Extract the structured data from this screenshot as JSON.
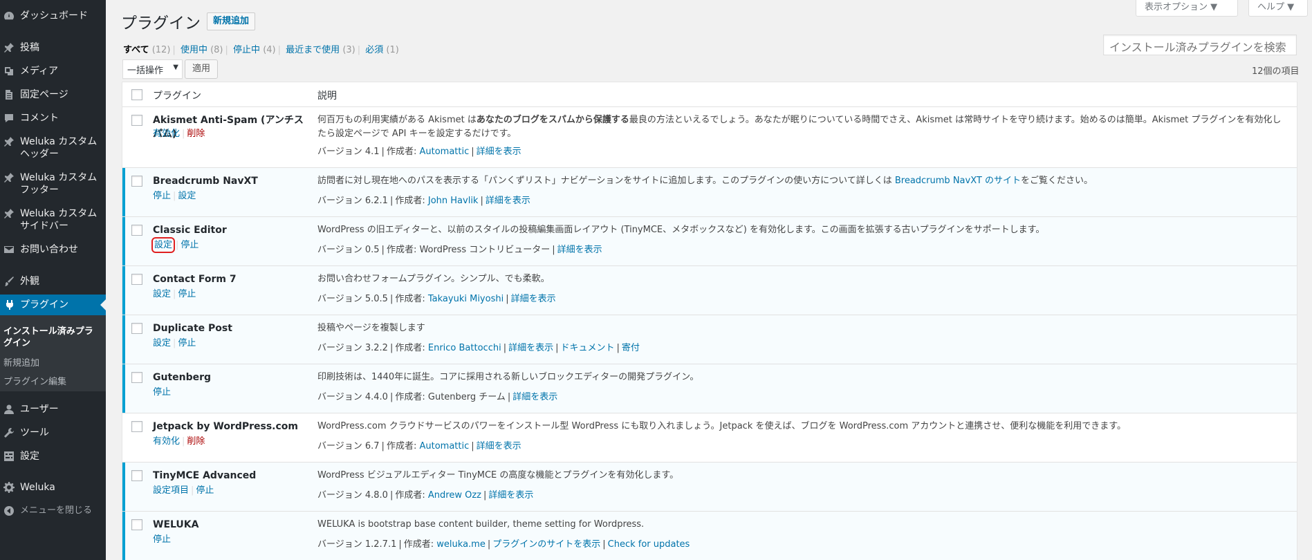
{
  "sidebar": {
    "items": [
      {
        "label": "ダッシュボード",
        "icon": "dashboard-icon"
      },
      {
        "label": "投稿",
        "icon": "pin-icon"
      },
      {
        "label": "メディア",
        "icon": "media-icon"
      },
      {
        "label": "固定ページ",
        "icon": "page-icon"
      },
      {
        "label": "コメント",
        "icon": "comment-icon"
      },
      {
        "label": "Weluka カスタムヘッダー",
        "icon": "pin-icon"
      },
      {
        "label": "Weluka カスタムフッター",
        "icon": "pin-icon"
      },
      {
        "label": "Weluka カスタムサイドバー",
        "icon": "pin-icon"
      },
      {
        "label": "お問い合わせ",
        "icon": "mail-icon"
      },
      {
        "label": "外観",
        "icon": "brush-icon"
      },
      {
        "label": "プラグイン",
        "icon": "plugin-icon"
      },
      {
        "label": "ユーザー",
        "icon": "user-icon"
      },
      {
        "label": "ツール",
        "icon": "wrench-icon"
      },
      {
        "label": "設定",
        "icon": "settings-icon"
      },
      {
        "label": "Weluka",
        "icon": "gear-icon"
      },
      {
        "label": "メニューを閉じる",
        "icon": "collapse-icon"
      }
    ],
    "submenu": [
      "インストール済みプラグイン",
      "新規追加",
      "プラグイン編集"
    ]
  },
  "header": {
    "title": "プラグイン",
    "add_new": "新規追加",
    "screen_options": "表示オプション ▼",
    "help": "ヘルプ ▼"
  },
  "filters": [
    {
      "label": "すべて",
      "count": "(12)"
    },
    {
      "label": "使用中",
      "count": "(8)"
    },
    {
      "label": "停止中",
      "count": "(4)"
    },
    {
      "label": "最近まで使用",
      "count": "(3)"
    },
    {
      "label": "必須",
      "count": "(1)"
    }
  ],
  "search": {
    "placeholder": "インストール済みプラグインを検索"
  },
  "bulk": {
    "select": "一括操作",
    "apply": "適用",
    "count": "12個の項目"
  },
  "table": {
    "col_plugin": "プラグイン",
    "col_desc": "説明",
    "rows": [
      {
        "name": "Akismet Anti-Spam (アンチスパム)",
        "actions": [
          "有効化",
          "削除"
        ],
        "desc_parts": [
          "何百万もの利用実績がある Akismet は",
          "あなたのブログをスパムから保護する",
          "最良の方法といえるでしょう。あなたが眠りについている時間でさえ、Akismet は常時サイトを守り続けます。始めるのは簡単。Akismet プラグインを有効化したら設定ページで API キーを設定するだけです。"
        ],
        "version": "バージョン 4.1",
        "author_label": "作成者:",
        "author": "Automattic",
        "links": [
          "詳細を表示"
        ]
      },
      {
        "name": "Breadcrumb NavXT",
        "actions": [
          "停止",
          "設定"
        ],
        "desc_parts": [
          "訪問者に対し現在地へのパスを表示する「パンくずリスト」ナビゲーションをサイトに追加します。このプラグインの使い方について詳しくは ",
          "Breadcrumb NavXT のサイト",
          "をご覧ください。"
        ],
        "version": "バージョン 6.2.1",
        "author_label": "作成者:",
        "author": "John Havlik",
        "links": [
          "詳細を表示"
        ]
      },
      {
        "name": "Classic Editor",
        "actions": [
          "設定",
          "停止"
        ],
        "desc": "WordPress の旧エディターと、以前のスタイルの投稿編集画面レイアウト (TinyMCE、メタボックスなど) を有効化します。この画面を拡張する古いプラグインをサポートします。",
        "version": "バージョン 0.5",
        "author_label": "作成者:",
        "author": "WordPress コントリビューター",
        "links": [
          "詳細を表示"
        ]
      },
      {
        "name": "Contact Form 7",
        "actions": [
          "設定",
          "停止"
        ],
        "desc": "お問い合わせフォームプラグイン。シンプル、でも柔軟。",
        "version": "バージョン 5.0.5",
        "author_label": "作成者:",
        "author": "Takayuki Miyoshi",
        "links": [
          "詳細を表示"
        ]
      },
      {
        "name": "Duplicate Post",
        "actions": [
          "設定",
          "停止"
        ],
        "desc": "投稿やページを複製します",
        "version": "バージョン 3.2.2",
        "author_label": "作成者:",
        "author": "Enrico Battocchi",
        "links": [
          "詳細を表示",
          "ドキュメント",
          "寄付"
        ]
      },
      {
        "name": "Gutenberg",
        "actions": [
          "停止"
        ],
        "desc": "印刷技術は、1440年に誕生。コアに採用される新しいブロックエディターの開発プラグイン。",
        "version": "バージョン 4.4.0",
        "author_label": "作成者:",
        "author": "Gutenberg チーム",
        "links": [
          "詳細を表示"
        ]
      },
      {
        "name": "Jetpack by WordPress.com",
        "actions": [
          "有効化",
          "削除"
        ],
        "desc": "WordPress.com クラウドサービスのパワーをインストール型 WordPress にも取り入れましょう。Jetpack を使えば、ブログを WordPress.com アカウントと連携させ、便利な機能を利用できます。",
        "version": "バージョン 6.7",
        "author_label": "作成者:",
        "author": "Automattic",
        "links": [
          "詳細を表示"
        ]
      },
      {
        "name": "TinyMCE Advanced",
        "actions": [
          "設定項目",
          "停止"
        ],
        "desc": "WordPress ビジュアルエディター TinyMCE の高度な機能とプラグインを有効化します。",
        "version": "バージョン 4.8.0",
        "author_label": "作成者:",
        "author": "Andrew Ozz",
        "links": [
          "詳細を表示"
        ]
      },
      {
        "name": "WELUKA",
        "actions": [
          "停止"
        ],
        "desc": "WELUKA is bootstrap base content builder, theme setting for Wordpress.",
        "version": "バージョン 1.2.7.1",
        "author_label": "作成者:",
        "author": "weluka.me",
        "links": [
          "プラグインのサイトを表示",
          "Check for updates"
        ]
      }
    ]
  }
}
